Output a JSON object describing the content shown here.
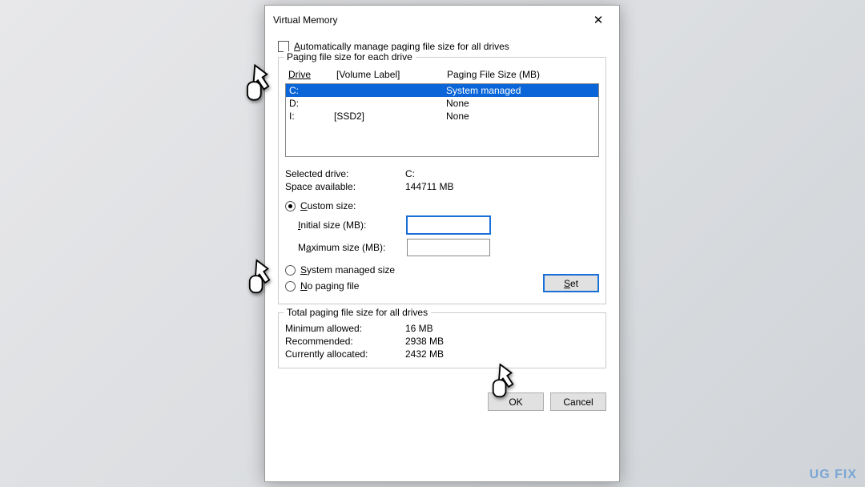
{
  "dialog": {
    "title": "Virtual Memory",
    "auto_manage_label_pre": "A",
    "auto_manage_label_rest": "utomatically manage paging file size for all drives",
    "group1_legend": "Paging file size for each drive",
    "header_drive_pre": "D",
    "header_drive_rest": "rive",
    "header_vol": "[Volume Label]",
    "header_size": "Paging File Size (MB)",
    "drives": [
      {
        "letter": "C:",
        "label": "",
        "size": "System managed",
        "selected": true
      },
      {
        "letter": "D:",
        "label": "",
        "size": "None",
        "selected": false
      },
      {
        "letter": "I:",
        "label": "[SSD2]",
        "size": "None",
        "selected": false
      }
    ],
    "selected_drive_label": "Selected drive:",
    "selected_drive_value": "C:",
    "space_avail_label": "Space available:",
    "space_avail_value": "144711 MB",
    "custom_pre": "C",
    "custom_rest": "ustom size:",
    "initial_pre": "I",
    "initial_rest": "nitial size (MB):",
    "max_pre": "M",
    "max_mid": "a",
    "max_rest": "ximum size (MB):",
    "sysmanaged_rest": "ystem managed size",
    "sysmanaged_pre": "S",
    "nopaging_pre": "N",
    "nopaging_rest": "o paging file",
    "set_pre": "S",
    "set_rest": "et",
    "group2_legend": "Total paging file size for all drives",
    "min_label": "Minimum allowed:",
    "min_value": "16 MB",
    "rec_label": "Recommended:",
    "rec_value": "2938 MB",
    "cur_label": "Currently allocated:",
    "cur_value": "2432 MB",
    "ok": "OK",
    "cancel": "Cancel"
  },
  "watermark": "UG    FIX",
  "initial_value": "",
  "max_value": ""
}
